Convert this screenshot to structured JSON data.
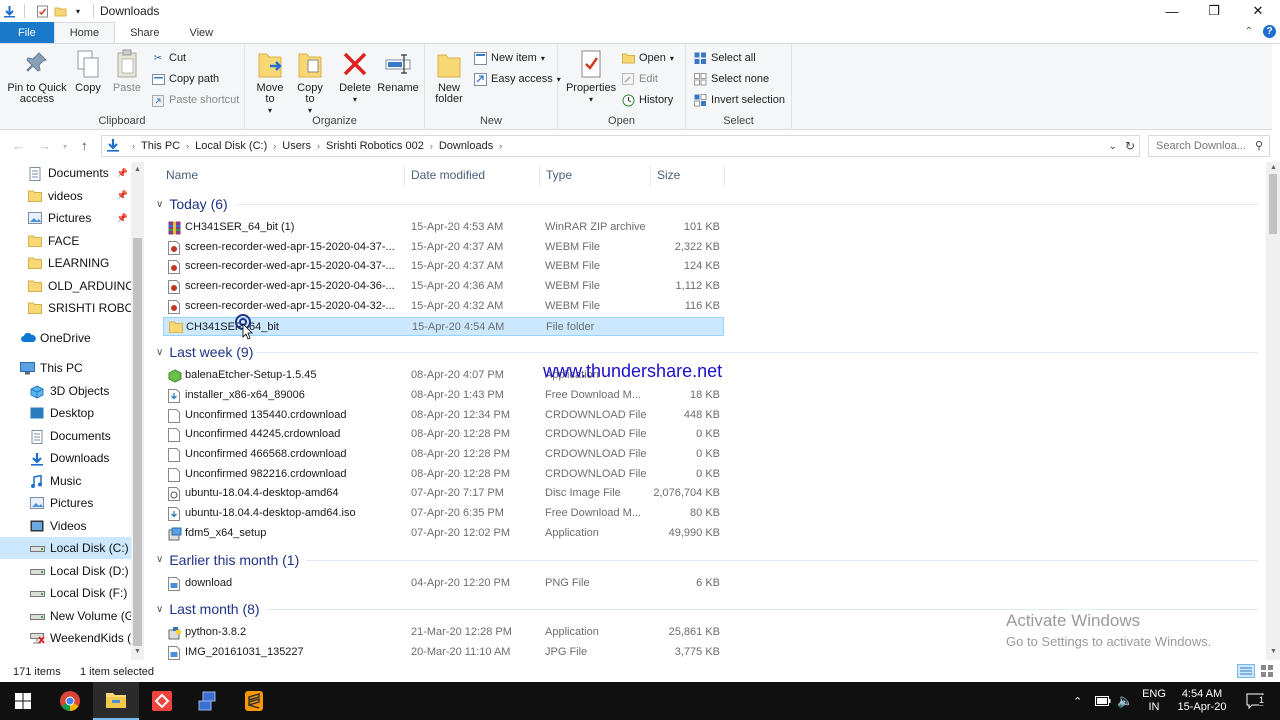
{
  "window": {
    "title": "Downloads",
    "controls": {
      "minimize": "—",
      "maximize": "❐",
      "close": "✕"
    }
  },
  "tabs": [
    {
      "label": "File"
    },
    {
      "label": "Home"
    },
    {
      "label": "Share"
    },
    {
      "label": "View"
    }
  ],
  "ribbon": {
    "clipboard": {
      "label": "Clipboard",
      "pin": "Pin to Quick access",
      "pin_l1": "Pin to Quick",
      "pin_l2": "access",
      "copy": "Copy",
      "paste": "Paste",
      "cut": "Cut",
      "copy_path": "Copy path",
      "paste_shortcut": "Paste shortcut"
    },
    "organize": {
      "label": "Organize",
      "move_l1": "Move",
      "move_l2": "to",
      "copy_l1": "Copy",
      "copy_l2": "to",
      "delete": "Delete",
      "rename": "Rename"
    },
    "new": {
      "label": "New",
      "folder_l1": "New",
      "folder_l2": "folder",
      "new_item": "New item",
      "easy_access": "Easy access"
    },
    "open": {
      "label": "Open",
      "properties": "Properties",
      "open": "Open",
      "edit": "Edit",
      "history": "History"
    },
    "select": {
      "label": "Select",
      "select_all": "Select all",
      "select_none": "Select none",
      "invert": "Invert selection"
    }
  },
  "address": {
    "crumbs": [
      "This PC",
      "Local Disk (C:)",
      "Users",
      "Srishti Robotics 002",
      "Downloads"
    ],
    "search_placeholder": "Search Downloa..."
  },
  "nav": [
    {
      "label": "Documents",
      "icon": "documents-icon",
      "pinned": true
    },
    {
      "label": "videos",
      "icon": "folder-icon",
      "pinned": true
    },
    {
      "label": "Pictures",
      "icon": "pictures-icon",
      "pinned": true
    },
    {
      "label": "FACE",
      "icon": "folder-icon"
    },
    {
      "label": "LEARNING",
      "icon": "folder-icon"
    },
    {
      "label": "OLD_ARDUINO_",
      "icon": "folder-icon"
    },
    {
      "label": "SRISHTI ROBOTIC",
      "icon": "folder-icon"
    },
    {
      "label": "OneDrive",
      "icon": "onedrive-icon"
    },
    {
      "label": "This PC",
      "icon": "computer-icon"
    },
    {
      "label": "3D Objects",
      "icon": "3d-objects-icon"
    },
    {
      "label": "Desktop",
      "icon": "desktop-icon"
    },
    {
      "label": "Documents",
      "icon": "documents-icon"
    },
    {
      "label": "Downloads",
      "icon": "downloads-icon"
    },
    {
      "label": "Music",
      "icon": "music-icon"
    },
    {
      "label": "Pictures",
      "icon": "pictures-icon"
    },
    {
      "label": "Videos",
      "icon": "videos-icon"
    },
    {
      "label": "Local Disk (C:)",
      "icon": "drive-icon",
      "selected": true
    },
    {
      "label": "Local Disk (D:)",
      "icon": "drive-icon"
    },
    {
      "label": "Local Disk (F:)",
      "icon": "drive-icon"
    },
    {
      "label": "New Volume (G:",
      "icon": "drive-icon"
    },
    {
      "label": "WeekendKids (\\\\",
      "icon": "network-drive-icon"
    }
  ],
  "columns": {
    "name": "Name",
    "date": "Date modified",
    "type": "Type",
    "size": "Size"
  },
  "groups": [
    {
      "label": "Today (6)",
      "files": [
        {
          "name": "CH341SER_64_bit (1)",
          "date": "15-Apr-20 4:53 AM",
          "type": "WinRAR ZIP archive",
          "size": "101 KB",
          "icon": "winrar-icon"
        },
        {
          "name": "screen-recorder-wed-apr-15-2020-04-37-...",
          "date": "15-Apr-20 4:37 AM",
          "type": "WEBM File",
          "size": "2,322 KB",
          "icon": "webm-file-icon"
        },
        {
          "name": "screen-recorder-wed-apr-15-2020-04-37-...",
          "date": "15-Apr-20 4:37 AM",
          "type": "WEBM File",
          "size": "124 KB",
          "icon": "webm-file-icon"
        },
        {
          "name": "screen-recorder-wed-apr-15-2020-04-36-...",
          "date": "15-Apr-20 4:36 AM",
          "type": "WEBM File",
          "size": "1,112 KB",
          "icon": "webm-file-icon"
        },
        {
          "name": "screen-recorder-wed-apr-15-2020-04-32-...",
          "date": "15-Apr-20 4:32 AM",
          "type": "WEBM File",
          "size": "116 KB",
          "icon": "webm-file-icon"
        },
        {
          "name": "CH341SER_64_bit",
          "date": "15-Apr-20 4:54 AM",
          "type": "File folder",
          "size": "",
          "icon": "folder-icon",
          "selected": true
        }
      ]
    },
    {
      "label": "Last week (9)",
      "files": [
        {
          "name": "balenaEtcher-Setup-1.5.45",
          "date": "08-Apr-20 4:07 PM",
          "type": "Application",
          "size": "",
          "icon": "etcher-icon"
        },
        {
          "name": "installer_x86-x64_89006",
          "date": "08-Apr-20 1:43 PM",
          "type": "Free Download M...",
          "size": "18 KB",
          "icon": "fdm-file-icon"
        },
        {
          "name": "Unconfirmed 135440.crdownload",
          "date": "08-Apr-20 12:34 PM",
          "type": "CRDOWNLOAD File",
          "size": "448 KB",
          "icon": "blank-file-icon"
        },
        {
          "name": "Unconfirmed 44245.crdownload",
          "date": "08-Apr-20 12:28 PM",
          "type": "CRDOWNLOAD File",
          "size": "0 KB",
          "icon": "blank-file-icon"
        },
        {
          "name": "Unconfirmed 466568.crdownload",
          "date": "08-Apr-20 12:28 PM",
          "type": "CRDOWNLOAD File",
          "size": "0 KB",
          "icon": "blank-file-icon"
        },
        {
          "name": "Unconfirmed 982216.crdownload",
          "date": "08-Apr-20 12:28 PM",
          "type": "CRDOWNLOAD File",
          "size": "0 KB",
          "icon": "blank-file-icon"
        },
        {
          "name": "ubuntu-18.04.4-desktop-amd64",
          "date": "07-Apr-20 7:17 PM",
          "type": "Disc Image File",
          "size": "2,076,704 KB",
          "icon": "disc-image-icon"
        },
        {
          "name": "ubuntu-18.04.4-desktop-amd64.iso",
          "date": "07-Apr-20 6:35 PM",
          "type": "Free Download M...",
          "size": "80 KB",
          "icon": "fdm-file-icon"
        },
        {
          "name": "fdm5_x64_setup",
          "date": "07-Apr-20 12:02 PM",
          "type": "Application",
          "size": "49,990 KB",
          "icon": "installer-icon"
        }
      ]
    },
    {
      "label": "Earlier this month (1)",
      "files": [
        {
          "name": "download",
          "date": "04-Apr-20 12:20 PM",
          "type": "PNG File",
          "size": "6 KB",
          "icon": "image-file-icon"
        }
      ]
    },
    {
      "label": "Last month (8)",
      "files": [
        {
          "name": "python-3.8.2",
          "date": "21-Mar-20 12:28 PM",
          "type": "Application",
          "size": "25,861 KB",
          "icon": "python-installer-icon"
        },
        {
          "name": "IMG_20161031_135227",
          "date": "20-Mar-20 11:10 AM",
          "type": "JPG File",
          "size": "3,775 KB",
          "icon": "image-file-icon"
        }
      ]
    }
  ],
  "overlay": {
    "watermark": "www.thundershare.net",
    "activate_title": "Activate Windows",
    "activate_sub": "Go to Settings to activate Windows."
  },
  "status": {
    "count": "171 items",
    "selected": "1 item selected"
  },
  "taskbar": {
    "lang": "ENG",
    "region": "IN",
    "time": "4:54 AM",
    "date": "15-Apr-20",
    "notif_count": "1"
  },
  "colors": {
    "accent": "#1979ca",
    "selection": "#cce8ff",
    "group_header": "#1e3287",
    "folder": "#f8d775"
  }
}
